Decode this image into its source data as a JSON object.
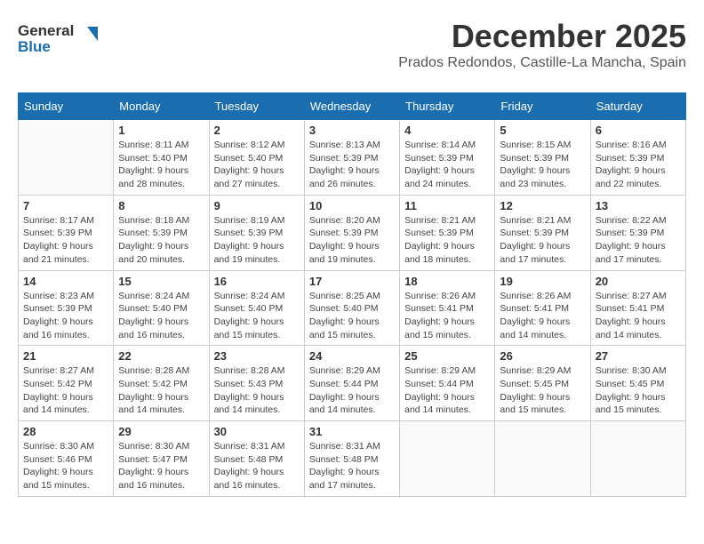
{
  "header": {
    "logo_line1": "General",
    "logo_line2": "Blue",
    "month_year": "December 2025",
    "location": "Prados Redondos, Castille-La Mancha, Spain"
  },
  "weekdays": [
    "Sunday",
    "Monday",
    "Tuesday",
    "Wednesday",
    "Thursday",
    "Friday",
    "Saturday"
  ],
  "weeks": [
    [
      {
        "day": "",
        "info": ""
      },
      {
        "day": "1",
        "info": "Sunrise: 8:11 AM\nSunset: 5:40 PM\nDaylight: 9 hours\nand 28 minutes."
      },
      {
        "day": "2",
        "info": "Sunrise: 8:12 AM\nSunset: 5:40 PM\nDaylight: 9 hours\nand 27 minutes."
      },
      {
        "day": "3",
        "info": "Sunrise: 8:13 AM\nSunset: 5:39 PM\nDaylight: 9 hours\nand 26 minutes."
      },
      {
        "day": "4",
        "info": "Sunrise: 8:14 AM\nSunset: 5:39 PM\nDaylight: 9 hours\nand 24 minutes."
      },
      {
        "day": "5",
        "info": "Sunrise: 8:15 AM\nSunset: 5:39 PM\nDaylight: 9 hours\nand 23 minutes."
      },
      {
        "day": "6",
        "info": "Sunrise: 8:16 AM\nSunset: 5:39 PM\nDaylight: 9 hours\nand 22 minutes."
      }
    ],
    [
      {
        "day": "7",
        "info": "Sunrise: 8:17 AM\nSunset: 5:39 PM\nDaylight: 9 hours\nand 21 minutes."
      },
      {
        "day": "8",
        "info": "Sunrise: 8:18 AM\nSunset: 5:39 PM\nDaylight: 9 hours\nand 20 minutes."
      },
      {
        "day": "9",
        "info": "Sunrise: 8:19 AM\nSunset: 5:39 PM\nDaylight: 9 hours\nand 19 minutes."
      },
      {
        "day": "10",
        "info": "Sunrise: 8:20 AM\nSunset: 5:39 PM\nDaylight: 9 hours\nand 19 minutes."
      },
      {
        "day": "11",
        "info": "Sunrise: 8:21 AM\nSunset: 5:39 PM\nDaylight: 9 hours\nand 18 minutes."
      },
      {
        "day": "12",
        "info": "Sunrise: 8:21 AM\nSunset: 5:39 PM\nDaylight: 9 hours\nand 17 minutes."
      },
      {
        "day": "13",
        "info": "Sunrise: 8:22 AM\nSunset: 5:39 PM\nDaylight: 9 hours\nand 17 minutes."
      }
    ],
    [
      {
        "day": "14",
        "info": "Sunrise: 8:23 AM\nSunset: 5:39 PM\nDaylight: 9 hours\nand 16 minutes."
      },
      {
        "day": "15",
        "info": "Sunrise: 8:24 AM\nSunset: 5:40 PM\nDaylight: 9 hours\nand 16 minutes."
      },
      {
        "day": "16",
        "info": "Sunrise: 8:24 AM\nSunset: 5:40 PM\nDaylight: 9 hours\nand 15 minutes."
      },
      {
        "day": "17",
        "info": "Sunrise: 8:25 AM\nSunset: 5:40 PM\nDaylight: 9 hours\nand 15 minutes."
      },
      {
        "day": "18",
        "info": "Sunrise: 8:26 AM\nSunset: 5:41 PM\nDaylight: 9 hours\nand 15 minutes."
      },
      {
        "day": "19",
        "info": "Sunrise: 8:26 AM\nSunset: 5:41 PM\nDaylight: 9 hours\nand 14 minutes."
      },
      {
        "day": "20",
        "info": "Sunrise: 8:27 AM\nSunset: 5:41 PM\nDaylight: 9 hours\nand 14 minutes."
      }
    ],
    [
      {
        "day": "21",
        "info": "Sunrise: 8:27 AM\nSunset: 5:42 PM\nDaylight: 9 hours\nand 14 minutes."
      },
      {
        "day": "22",
        "info": "Sunrise: 8:28 AM\nSunset: 5:42 PM\nDaylight: 9 hours\nand 14 minutes."
      },
      {
        "day": "23",
        "info": "Sunrise: 8:28 AM\nSunset: 5:43 PM\nDaylight: 9 hours\nand 14 minutes."
      },
      {
        "day": "24",
        "info": "Sunrise: 8:29 AM\nSunset: 5:44 PM\nDaylight: 9 hours\nand 14 minutes."
      },
      {
        "day": "25",
        "info": "Sunrise: 8:29 AM\nSunset: 5:44 PM\nDaylight: 9 hours\nand 14 minutes."
      },
      {
        "day": "26",
        "info": "Sunrise: 8:29 AM\nSunset: 5:45 PM\nDaylight: 9 hours\nand 15 minutes."
      },
      {
        "day": "27",
        "info": "Sunrise: 8:30 AM\nSunset: 5:45 PM\nDaylight: 9 hours\nand 15 minutes."
      }
    ],
    [
      {
        "day": "28",
        "info": "Sunrise: 8:30 AM\nSunset: 5:46 PM\nDaylight: 9 hours\nand 15 minutes."
      },
      {
        "day": "29",
        "info": "Sunrise: 8:30 AM\nSunset: 5:47 PM\nDaylight: 9 hours\nand 16 minutes."
      },
      {
        "day": "30",
        "info": "Sunrise: 8:31 AM\nSunset: 5:48 PM\nDaylight: 9 hours\nand 16 minutes."
      },
      {
        "day": "31",
        "info": "Sunrise: 8:31 AM\nSunset: 5:48 PM\nDaylight: 9 hours\nand 17 minutes."
      },
      {
        "day": "",
        "info": ""
      },
      {
        "day": "",
        "info": ""
      },
      {
        "day": "",
        "info": ""
      }
    ]
  ]
}
